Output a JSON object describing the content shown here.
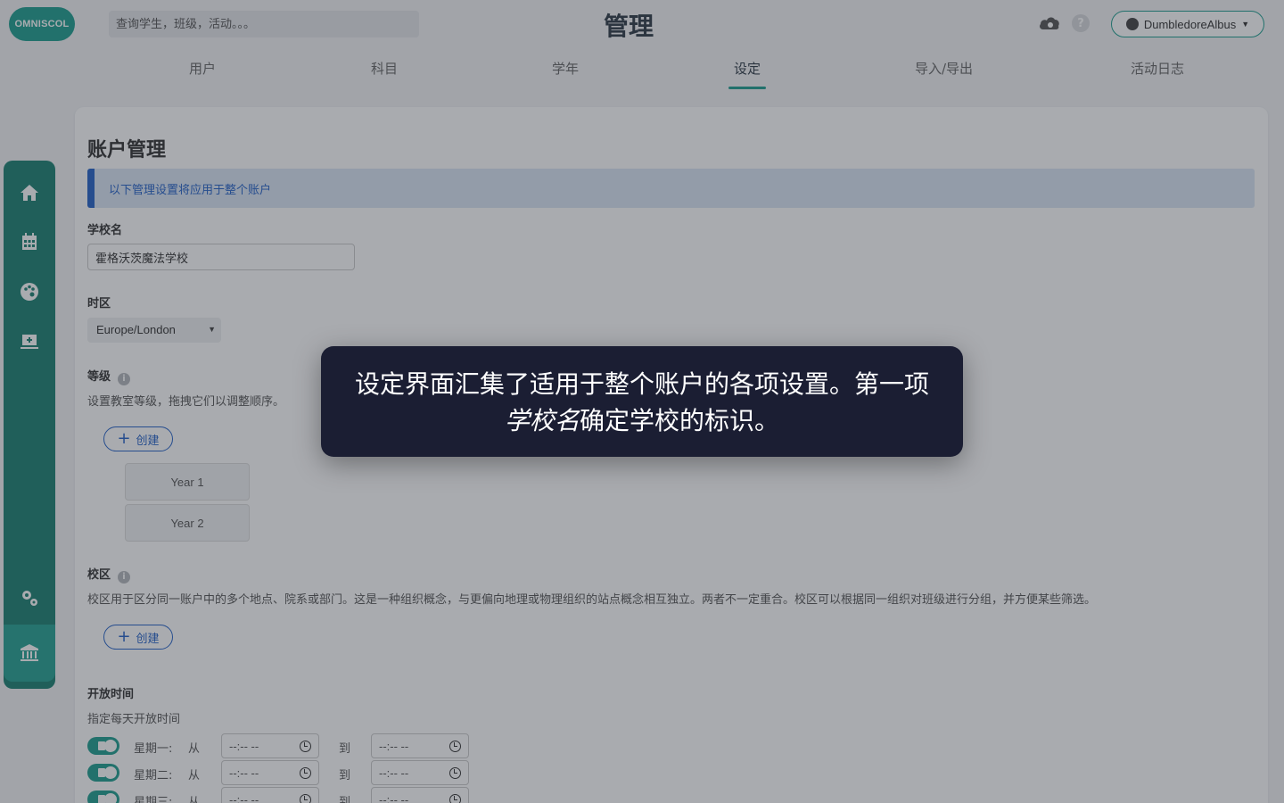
{
  "app": {
    "logo_text": "OMNISCOL",
    "page_title": "管理"
  },
  "search": {
    "placeholder": "查询学生，班级，活动。。。"
  },
  "user": {
    "name": "DumbledoreAlbus"
  },
  "help": {
    "label": "?"
  },
  "tabs": [
    {
      "label": "用户"
    },
    {
      "label": "科目"
    },
    {
      "label": "学年"
    },
    {
      "label": "设定",
      "active": true
    },
    {
      "label": "导入/导出"
    },
    {
      "label": "活动日志"
    }
  ],
  "sidebar": {
    "items": [
      "home-icon",
      "calendar-icon",
      "palette-icon",
      "laptop-plus-icon",
      "cogs-icon",
      "bank-icon"
    ],
    "active": "bank-icon"
  },
  "account": {
    "title": "账户管理",
    "notice": "以下管理设置将应用于整个账户",
    "school_name_label": "学校名",
    "school_name_value": "霍格沃茨魔法学校",
    "timezone_label": "时区",
    "timezone_value": "Europe/London",
    "grades_label": "等级",
    "grades_desc": "设置教室等级，拖拽它们以调整顺序。",
    "create_label": "创建",
    "grades": [
      "Year 1",
      "Year 2"
    ],
    "campus_label": "校区",
    "campus_desc": "校区用于区分同一账户中的多个地点、院系或部门。这是一种组织概念，与更偏向地理或物理组织的站点概念相互独立。两者不一定重合。校区可以根据同一组织对班级进行分组，并方便某些筛选。",
    "hours_label": "开放时间",
    "hours_desc": "指定每天开放时间",
    "from_label": "从",
    "to_label": "到",
    "time_placeholder": "--:-- --",
    "days": [
      "星期一:",
      "星期二:",
      "星期三:"
    ]
  },
  "tooltip": {
    "part1": "设定界面汇集了适用于整个账户的各项设置。第一项",
    "emphasis": "学校名",
    "part2": "确定学校的标识。"
  },
  "colors": {
    "accent": "#1f9e8f",
    "sidebar": "#1b8072",
    "link": "#2563c9",
    "tooltip_bg": "#1b1e33"
  }
}
